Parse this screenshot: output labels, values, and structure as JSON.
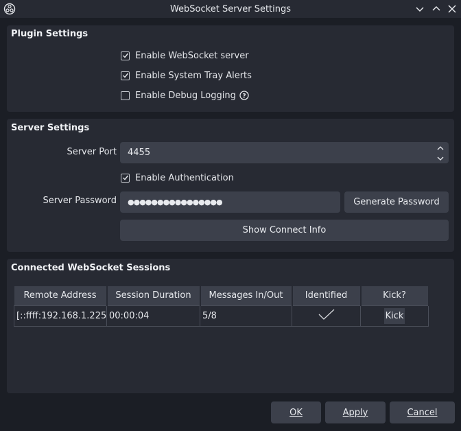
{
  "window": {
    "title": "WebSocket Server Settings",
    "icons": [
      "obs-logo-icon",
      "minimize-icon",
      "maximize-icon",
      "close-icon"
    ]
  },
  "plugin_settings": {
    "title": "Plugin Settings",
    "checks": [
      {
        "label": "Enable WebSocket server",
        "checked": true
      },
      {
        "label": "Enable System Tray Alerts",
        "checked": true
      },
      {
        "label": "Enable Debug Logging",
        "checked": false,
        "help_icon": "help-icon"
      }
    ]
  },
  "server_settings": {
    "title": "Server Settings",
    "port_label": "Server Port",
    "port_value": "4455",
    "auth_label": "Enable Authentication",
    "auth_checked": true,
    "password_label": "Server Password",
    "password_value": "●●●●●●●●●●●●●●●●",
    "generate_label": "Generate Password",
    "show_connect_label": "Show Connect Info"
  },
  "sessions": {
    "title": "Connected WebSocket Sessions",
    "columns": [
      "Remote Address",
      "Session Duration",
      "Messages In/Out",
      "Identified",
      "Kick?"
    ],
    "rows": [
      {
        "address": "[::ffff:192.168.1.225…",
        "duration": "00:00:04",
        "messages": "5/8",
        "identified": true,
        "kick_label": "Kick"
      }
    ]
  },
  "footer": {
    "ok": "OK",
    "apply": "Apply",
    "cancel": "Cancel"
  },
  "colors": {
    "background": "#1b1e25",
    "panel": "#272a33",
    "control": "#3c404b"
  }
}
